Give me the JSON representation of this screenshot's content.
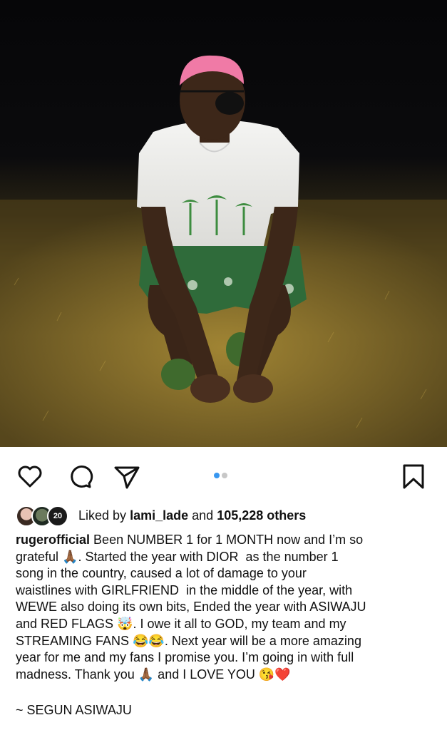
{
  "post": {
    "liked_by_prefix": "Liked by",
    "liked_by_user": "lami_lade",
    "liked_by_and": "and",
    "liked_by_count": "105,228 others",
    "avatar_badge": "20",
    "caption_username": "rugerofficial",
    "caption_text": "Been NUMBER 1 for 1 MONTH now and I’m so\ngrateful 🙏🏾. Started the year with DIOR  as the number 1\nsong in the country, caused a lot of damage to your\nwaistlines with GIRLFRIEND  in the middle of the year, with\nWEWE also doing its own bits, Ended the year with ASIWAJU\nand RED FLAGS 🤯. I owe it all to GOD, my team and my\nSTREAMING FANS 😂😂. Next year will be a more amazing\nyear for me and my fans I promise you. I’m going in with full\nmadness. Thank you 🙏🏾 and I LOVE YOU 😘❤️",
    "signoff": "~ SEGUN ASIWAJU",
    "carousel": {
      "current": 1,
      "total": 2
    }
  },
  "icons": {
    "like": "heart-icon",
    "comment": "comment-icon",
    "share": "send-icon",
    "save": "bookmark-icon"
  },
  "colors": {
    "active_dot": "#3897f0",
    "inactive_dot": "#c7c7c7",
    "text": "#111111"
  }
}
